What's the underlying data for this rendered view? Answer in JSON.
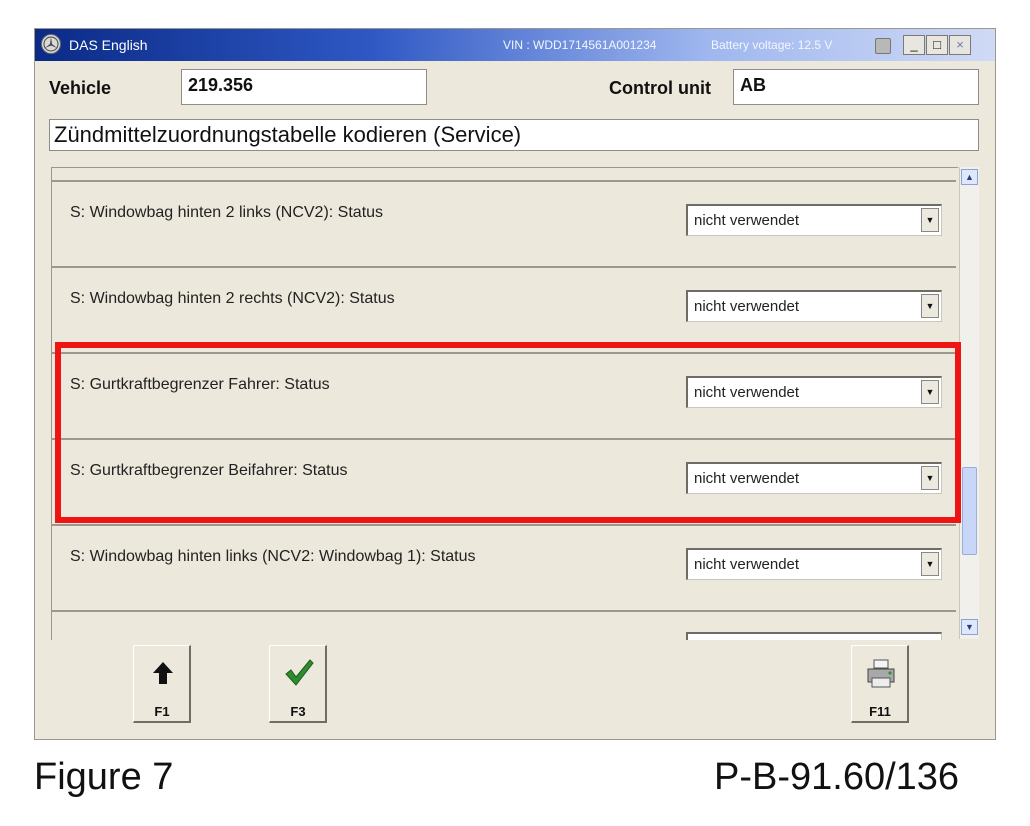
{
  "window": {
    "app_title": "DAS English",
    "vin_text": "VIN : WDD1714561A001234",
    "battery_text": "Battery voltage: 12.5 V",
    "minimize_label": "_",
    "maximize_label": "□",
    "close_label": "×"
  },
  "header": {
    "vehicle_label": "Vehicle",
    "vehicle_value": "219.356",
    "control_unit_label": "Control unit",
    "control_unit_value": "AB",
    "service_title": "Zündmittelzuordnungstabelle kodieren (Service)"
  },
  "list": {
    "rows": [
      {
        "label": "S: Windowbag hinten 2 links (NCV2): Status",
        "value": "nicht verwendet"
      },
      {
        "label": "S: Windowbag hinten 2 rechts (NCV2): Status",
        "value": "nicht verwendet"
      },
      {
        "label": "S: Gurtkraftbegrenzer Fahrer: Status",
        "value": "nicht verwendet"
      },
      {
        "label": "S: Gurtkraftbegrenzer Beifahrer: Status",
        "value": "nicht verwendet"
      },
      {
        "label": "S: Windowbag hinten links (NCV2: Windowbag 1): Status",
        "value": "nicht verwendet"
      }
    ]
  },
  "scrollbar": {
    "up_glyph": "▲",
    "down_glyph": "▼"
  },
  "dropdown_glyph": "▼",
  "function_keys": [
    {
      "label": "F1",
      "icon": "arrow-up-icon"
    },
    {
      "label": "F3",
      "icon": "checkmark-icon"
    },
    {
      "label": "F11",
      "icon": "printer-icon"
    }
  ],
  "colors": {
    "highlight": "#ef1414",
    "checkmark": "#2e8b2e",
    "titlebar": "#0a2a86"
  },
  "caption": {
    "figure": "Figure 7",
    "reference": "P-B-91.60/136"
  }
}
